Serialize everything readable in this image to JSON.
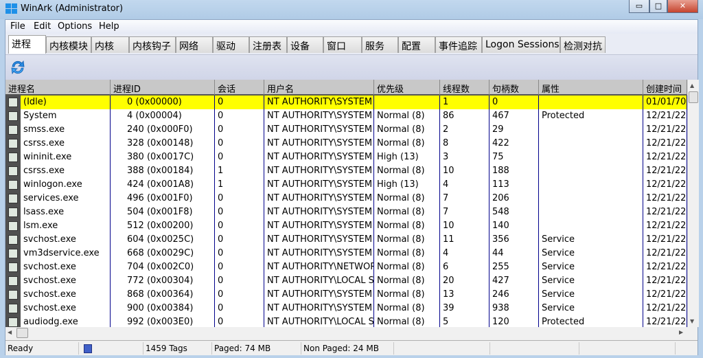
{
  "window": {
    "title": "WinArk  (Administrator)",
    "minimize": "▭",
    "maximize": "□",
    "close": "✕"
  },
  "menu": [
    "File",
    "Edit",
    "Options",
    "Help"
  ],
  "tabs": [
    "进程",
    "内核模块",
    "内核",
    "内核钩子",
    "网络",
    "驱动",
    "注册表",
    "设备",
    "窗口",
    "服务",
    "配置",
    "事件追踪",
    "Logon Sessions",
    "检测对抗"
  ],
  "active_tab": 0,
  "toolbar": {
    "refresh_icon": "refresh-icon"
  },
  "columns": [
    "进程名",
    "进程ID",
    "会话",
    "用户名",
    "优先级",
    "线程数",
    "句柄数",
    "属性",
    "创建时间"
  ],
  "rows": [
    [
      "(Idle)",
      "0 (0x00000)",
      "0",
      "NT AUTHORITY\\SYSTEM",
      "",
      "1",
      "0",
      "",
      "01/01/70"
    ],
    [
      "System",
      "4 (0x00004)",
      "0",
      "NT AUTHORITY\\SYSTEM",
      "Normal (8)",
      "86",
      "467",
      "Protected",
      "12/21/22"
    ],
    [
      "smss.exe",
      "240 (0x000F0)",
      "0",
      "NT AUTHORITY\\SYSTEM",
      "Normal (8)",
      "2",
      "29",
      "",
      "12/21/22"
    ],
    [
      "csrss.exe",
      "328 (0x00148)",
      "0",
      "NT AUTHORITY\\SYSTEM",
      "Normal (8)",
      "8",
      "422",
      "",
      "12/21/22"
    ],
    [
      "wininit.exe",
      "380 (0x0017C)",
      "0",
      "NT AUTHORITY\\SYSTEM",
      "High (13)",
      "3",
      "75",
      "",
      "12/21/22"
    ],
    [
      "csrss.exe",
      "388 (0x00184)",
      "1",
      "NT AUTHORITY\\SYSTEM",
      "Normal (8)",
      "10",
      "188",
      "",
      "12/21/22"
    ],
    [
      "winlogon.exe",
      "424 (0x001A8)",
      "1",
      "NT AUTHORITY\\SYSTEM",
      "High (13)",
      "4",
      "113",
      "",
      "12/21/22"
    ],
    [
      "services.exe",
      "496 (0x001F0)",
      "0",
      "NT AUTHORITY\\SYSTEM",
      "Normal (8)",
      "7",
      "206",
      "",
      "12/21/22"
    ],
    [
      "lsass.exe",
      "504 (0x001F8)",
      "0",
      "NT AUTHORITY\\SYSTEM",
      "Normal (8)",
      "7",
      "548",
      "",
      "12/21/22"
    ],
    [
      "lsm.exe",
      "512 (0x00200)",
      "0",
      "NT AUTHORITY\\SYSTEM",
      "Normal (8)",
      "10",
      "140",
      "",
      "12/21/22"
    ],
    [
      "svchost.exe",
      "604 (0x0025C)",
      "0",
      "NT AUTHORITY\\SYSTEM",
      "Normal (8)",
      "11",
      "356",
      "Service",
      "12/21/22"
    ],
    [
      "vm3dservice.exe",
      "668 (0x0029C)",
      "0",
      "NT AUTHORITY\\SYSTEM",
      "Normal (8)",
      "4",
      "44",
      "Service",
      "12/21/22"
    ],
    [
      "svchost.exe",
      "704 (0x002C0)",
      "0",
      "NT AUTHORITY\\NETWORK SERVICE",
      "Normal (8)",
      "6",
      "255",
      "Service",
      "12/21/22"
    ],
    [
      "svchost.exe",
      "772 (0x00304)",
      "0",
      "NT AUTHORITY\\LOCAL SERVICE",
      "Normal (8)",
      "20",
      "427",
      "Service",
      "12/21/22"
    ],
    [
      "svchost.exe",
      "868 (0x00364)",
      "0",
      "NT AUTHORITY\\SYSTEM",
      "Normal (8)",
      "13",
      "246",
      "Service",
      "12/21/22"
    ],
    [
      "svchost.exe",
      "900 (0x00384)",
      "0",
      "NT AUTHORITY\\SYSTEM",
      "Normal (8)",
      "39",
      "938",
      "Service",
      "12/21/22"
    ],
    [
      "audiodg.exe",
      "992 (0x003E0)",
      "0",
      "NT AUTHORITY\\LOCAL SERVICE",
      "Normal (8)",
      "5",
      "120",
      "Protected",
      "12/21/22"
    ]
  ],
  "selected_row": 0,
  "status": {
    "ready": "Ready",
    "tags": "1459 Tags",
    "paged": "Paged: 74 MB",
    "nonpaged": "Non Paged: 24 MB"
  },
  "colors": {
    "selection": "#ffff00",
    "grid_line": "#00008b",
    "header": "#c8c8c8"
  }
}
